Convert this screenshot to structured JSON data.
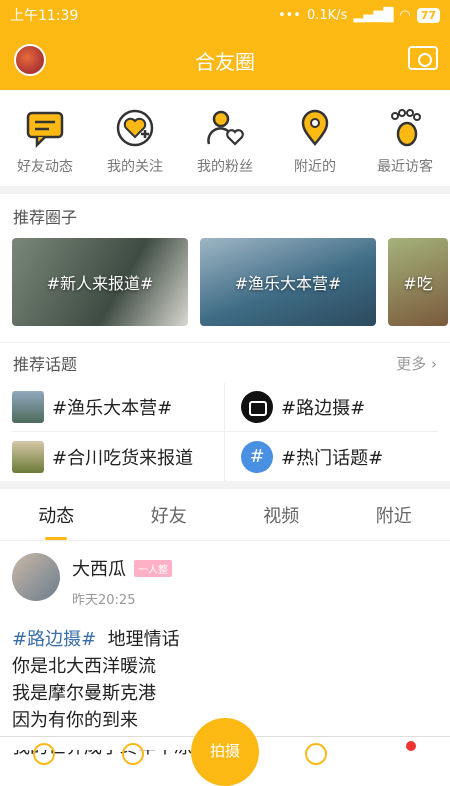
{
  "status": {
    "time": "上午11:39",
    "speed": "0.1K/s",
    "battery": "77"
  },
  "header": {
    "title": "合友圈"
  },
  "quick": [
    {
      "label": "好友动态",
      "icon": "chat-icon"
    },
    {
      "label": "我的关注",
      "icon": "heart-plus-icon"
    },
    {
      "label": "我的粉丝",
      "icon": "person-heart-icon"
    },
    {
      "label": "附近的",
      "icon": "location-pin-icon"
    },
    {
      "label": "最近访客",
      "icon": "footprint-icon"
    }
  ],
  "circles": {
    "title": "推荐圈子",
    "items": [
      "#新人来报道#",
      "#渔乐大本营#",
      "#吃"
    ]
  },
  "topics": {
    "title": "推荐话题",
    "more": "更多",
    "items": [
      "#渔乐大本营#",
      "#路边摄#",
      "#合川吃货来报道",
      "#热门话题#"
    ]
  },
  "tabs": [
    "动态",
    "好友",
    "视频",
    "附近"
  ],
  "post": {
    "name": "大西瓜",
    "badge": "一人整",
    "time": "昨天20:25",
    "tag": "#路边摄#",
    "title": "地理情话",
    "lines": [
      "你是北大西洋暖流",
      "我是摩尔曼斯克港",
      "因为有你的到来",
      "我的世界成了终年不冻港"
    ],
    "emoji": "❤"
  },
  "nav": {
    "fab_label": "拍摄"
  },
  "colors": {
    "accent": "#fdb913",
    "tag": "#3a6ea8"
  }
}
